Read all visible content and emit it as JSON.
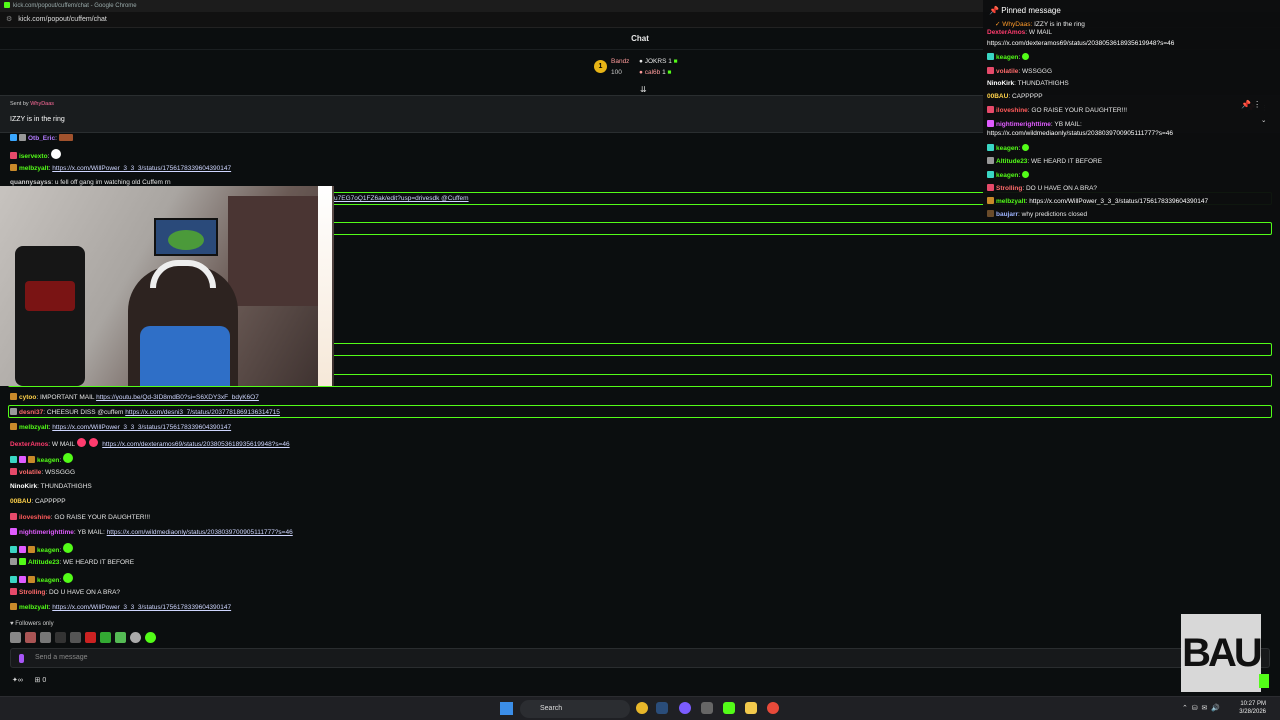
{
  "browser": {
    "tab_title": "kick.com/popout/cuffem/chat - Google Chrome",
    "url": "kick.com/popout/cuffem/chat"
  },
  "chat": {
    "header": "Chat",
    "leaderboard": [
      {
        "name": "Bandz",
        "value": "100"
      },
      {
        "name": "JOKRS",
        "value": "1"
      },
      {
        "name": "cal6b",
        "value": "1"
      }
    ],
    "pinned": {
      "sent_by_label": "Sent by",
      "sender": "WhyDaas",
      "message": "IZZY is in the ring"
    },
    "messages_top": [
      {
        "user": "Otb_Eric",
        "color": "#b47cff",
        "text": ""
      },
      {
        "user": "iservexto",
        "color": "#53fc18",
        "text": ""
      },
      {
        "user": "melbzyalt",
        "color": "#53fc18",
        "text": "",
        "link": "https://x.com/WillPower_3_3_3/status/1756178339604390147"
      },
      {
        "user": "quannysayss",
        "color": "#cccccc",
        "text": "u fell off gang im watching old Cuffem rn"
      }
    ],
    "partial_line": "u7EG7oQ1FZ6ak/edit?usp=drivesdk @Cuffem",
    "messages": [
      {
        "user": "cytoo",
        "color": "#ffd24a",
        "text": "IMPORTANT MAIL",
        "link": "https://youtu.be/Qd-3ID8mdB0?si=S6XDY3xF_bdyK6O7"
      },
      {
        "user": "desni37",
        "color": "#ff6b6b",
        "text": "CHEESUR DISS @cuffem",
        "link": "https://x.com/desni3_7/status/2037781869136314715"
      },
      {
        "user": "melbzyalt",
        "color": "#53fc18",
        "text": "",
        "link": "https://x.com/WillPower_3_3_3/status/1756178339604390147"
      },
      {
        "user": "DexterAmos",
        "color": "#ff3c6e",
        "text": "W MAIL",
        "link": "https://x.com/dexteramos69/status/2038053618935619948?s=46"
      },
      {
        "user": "keagen",
        "color": "#53fc18",
        "text": ""
      },
      {
        "user": "volatile",
        "color": "#ff6b6b",
        "text": "WSSGGG"
      },
      {
        "user": "NinoKirk",
        "color": "#ffffff",
        "text": "THUNDATHIGHS"
      },
      {
        "user": "00BAU",
        "color": "#ffd24a",
        "text": "CAPPPPP"
      },
      {
        "user": "iloveshine",
        "color": "#ff5a5a",
        "text": "GO RAISE YOUR DAUGHTER!!!"
      },
      {
        "user": "nightimerighttime",
        "color": "#e05bff",
        "text": "YB MAIL",
        "link": "https://x.com/wildmediaonly/status/2038039700905111777?s=46"
      },
      {
        "user": "keagen",
        "color": "#53fc18",
        "text": ""
      },
      {
        "user": "Altitude23",
        "color": "#53fc18",
        "text": "WE HEARD IT BEFORE"
      },
      {
        "user": "keagen",
        "color": "#53fc18",
        "text": ""
      },
      {
        "user": "Strolling",
        "color": "#ff6b6b",
        "text": "DO U HAVE ON A BRA?"
      },
      {
        "user": "melbzyalt",
        "color": "#53fc18",
        "text": "",
        "link": "https://x.com/WillPower_3_3_3/status/1756178339604390147"
      }
    ],
    "followers_only": "Followers only",
    "input_placeholder": "Send a message",
    "points": "0"
  },
  "side_panel": {
    "title": "Pinned message",
    "pinned_sender": "WhyDaas",
    "pinned_text": "IZZY is in the ring",
    "messages": [
      {
        "user": "DexterAmos",
        "color": "#ff3c6e",
        "text": "W MAIL"
      },
      {
        "user": "",
        "color": "#ffffff",
        "text": "https://x.com/dexteramos69/status/2038053618935619948?s=46"
      },
      {
        "user": "keagen",
        "color": "#53fc18",
        "text": ""
      },
      {
        "user": "volatile",
        "color": "#ff6b6b",
        "text": "WSSGGG"
      },
      {
        "user": "NinoKirk",
        "color": "#ffffff",
        "text": "THUNDATHIGHS"
      },
      {
        "user": "00BAU",
        "color": "#ffd24a",
        "text": "CAPPPPP"
      },
      {
        "user": "iloveshine",
        "color": "#ff5a5a",
        "text": "GO RAISE YOUR DAUGHTER!!!"
      },
      {
        "user": "nightimerighttime",
        "color": "#e05bff",
        "text": "YB MAIL:"
      },
      {
        "user": "",
        "color": "#ffffff",
        "text": "https://x.com/wildmediaonly/status/2038039700905111777?s=46"
      },
      {
        "user": "keagen",
        "color": "#53fc18",
        "text": ""
      },
      {
        "user": "Altitude23",
        "color": "#53fc18",
        "text": "WE HEARD IT BEFORE"
      },
      {
        "user": "keagen",
        "color": "#53fc18",
        "text": ""
      },
      {
        "user": "Strolling",
        "color": "#ff6b6b",
        "text": "DO U HAVE ON A BRA?"
      },
      {
        "user": "melbzyalt",
        "color": "#53fc18",
        "text": "https://x.com/WillPower_3_3_3/status/1756178339604390147"
      },
      {
        "user": "baujarr",
        "color": "#9fb4ff",
        "text": "why predictions closed"
      }
    ]
  },
  "overlay": {
    "logo_text": "BAU"
  },
  "taskbar": {
    "search_label": "Search",
    "time": "10:27 PM",
    "date": "3/28/2026"
  }
}
